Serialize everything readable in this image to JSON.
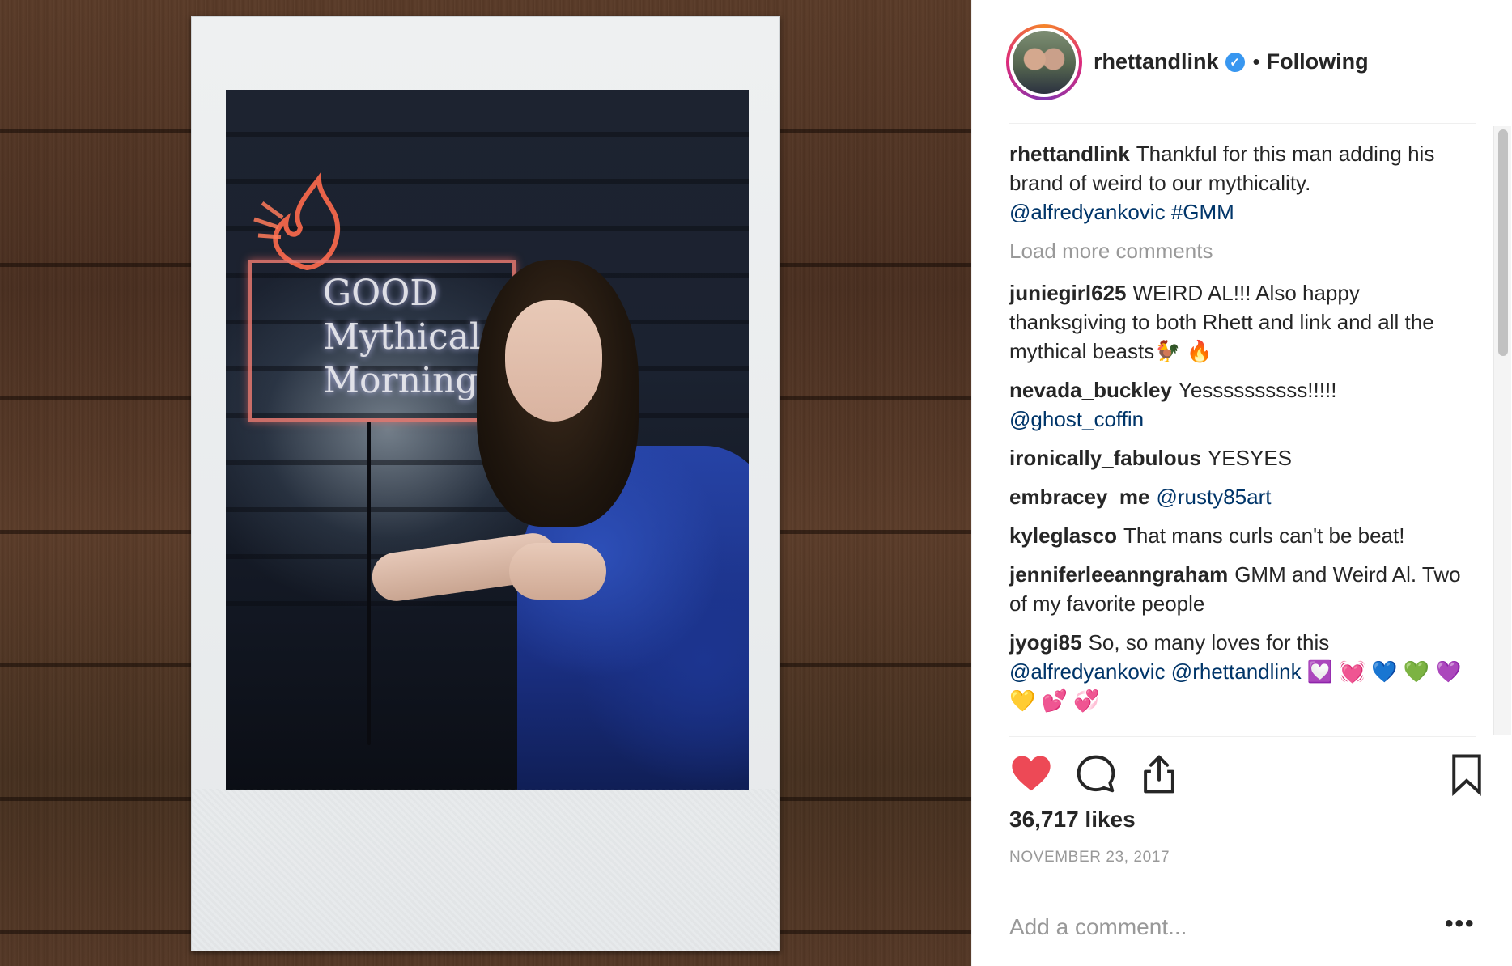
{
  "post": {
    "author": "rhettandlink",
    "follow_separator": "•",
    "follow_status": "Following",
    "verified_glyph": "✓",
    "caption": {
      "user": "rhettandlink",
      "text": "Thankful for this man adding his brand of weird to our mythicality.",
      "mention": "@alfredyankovic",
      "hashtag": "#GMM"
    },
    "load_more": "Load more comments",
    "comments": [
      {
        "user": "juniegirl625",
        "text": "WEIRD AL!!! Also happy thanksgiving to both Rhett and link and all the mythical beasts🐓 🔥",
        "mention": ""
      },
      {
        "user": "nevada_buckley",
        "text": "Yessssssssss!!!!!",
        "mention": "@ghost_coffin"
      },
      {
        "user": "ironically_fabulous",
        "text": "YESYES",
        "mention": ""
      },
      {
        "user": "embracey_me",
        "text": "",
        "mention": "@rusty85art"
      },
      {
        "user": "kyleglasco",
        "text": "That mans curls can't be beat!",
        "mention": ""
      },
      {
        "user": "jenniferleeanngraham",
        "text": "GMM and Weird Al. Two of my favorite people",
        "mention": ""
      },
      {
        "user": "jyogi85",
        "text": "So, so many loves for this",
        "mention": "@alfredyankovic @rhettandlink 💟 💓 💙 💚 💜 💛 💕 💞"
      }
    ],
    "likes": "36,717 likes",
    "date": "NOVEMBER 23, 2017",
    "add_comment_placeholder": "Add a comment...",
    "more_glyph": "•••"
  },
  "photo": {
    "neon_sign_text": "GOOD\nMythical\nMorning"
  },
  "colors": {
    "like_active": "#ed4956",
    "mention": "#003569",
    "verified": "#3897f0",
    "muted": "#999999"
  },
  "icons": {
    "like": "heart-icon",
    "comment": "comment-icon",
    "share": "share-icon",
    "save": "bookmark-icon",
    "more": "more-icon"
  }
}
